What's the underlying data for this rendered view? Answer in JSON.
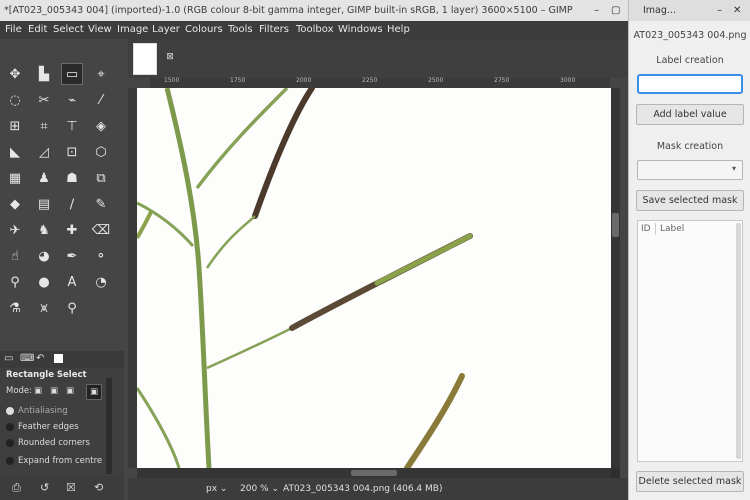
{
  "gimp": {
    "title": "*[AT023_005343 004] (imported)-1.0 (RGB colour 8-bit gamma integer, GIMP built-in sRGB, 1 layer) 3600×5100 – GIMP",
    "window_minimize": "–",
    "window_maximize": "▢",
    "menu": [
      "File",
      "Edit",
      "Select",
      "View",
      "Image",
      "Layer",
      "Colours",
      "Tools",
      "Filters",
      "Toolbox",
      "Windows",
      "Help"
    ],
    "ruler_ticks": [
      "1500",
      "1750",
      "2000",
      "2250",
      "2500",
      "2750",
      "3000"
    ],
    "tool_options": {
      "title": "Rectangle Select",
      "mode_label": "Mode:",
      "options": [
        "Antialiasing",
        "Feather edges",
        "Rounded corners",
        "Expand from centre"
      ]
    },
    "status": {
      "unit": "px",
      "zoom": "200 %",
      "file_info": "AT023_005343 004.png (406.4 MB)"
    }
  },
  "panel": {
    "title": "Imag...",
    "filename": "AT023_005343 004.png",
    "label_creation": "Label creation",
    "label_input_value": "",
    "add_label_button": "Add label value",
    "mask_creation": "Mask creation",
    "mask_select_value": "",
    "save_mask_button": "Save selected mask",
    "table_headers": [
      "ID",
      "Label"
    ],
    "delete_mask_button": "Delete selected mask"
  },
  "icons": {
    "tools": [
      "move-tool-icon",
      "align-tool-icon",
      "rect-select-icon",
      "fuzzy-select-icon",
      "lasso-icon",
      "scissors-icon",
      "crop-icon",
      "perspective-icon",
      "unified-transform-icon",
      "warp-icon",
      "paths-icon",
      "text-icon",
      "cage-icon",
      "3d-transform-icon",
      "gradient-icon",
      "bucket-fill-icon",
      "paintbrush-icon",
      "pencil-icon",
      "airbrush-icon",
      "eraser-icon",
      "clone-icon",
      "heal-icon",
      "smudge-icon",
      "dodge-icon",
      "ink-icon",
      "blur-icon",
      "measure-icon",
      "zoom-icon"
    ]
  }
}
